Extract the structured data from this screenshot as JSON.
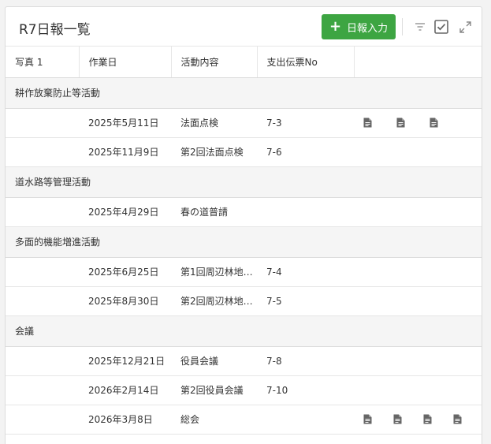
{
  "title": "R7日報一覧",
  "add_button": {
    "label": "日報入力",
    "color": "#3da542"
  },
  "toolbar": {
    "icons": [
      "filter-icon",
      "checkbox-icon",
      "expand-icon"
    ]
  },
  "columns": [
    "写真 1",
    "作業日",
    "活動内容",
    "支出伝票No",
    ""
  ],
  "groups": [
    {
      "name": "耕作放棄防止等活動",
      "rows": [
        {
          "date": "2025年5月11日",
          "activity": "法面点検",
          "voucher": "7-3",
          "attachments": 3
        },
        {
          "date": "2025年11月9日",
          "activity": "第2回法面点検",
          "voucher": "7-6",
          "attachments": 0
        }
      ]
    },
    {
      "name": "道水路等管理活動",
      "rows": [
        {
          "date": "2025年4月29日",
          "activity": "春の道普請",
          "voucher": "",
          "attachments": 0
        }
      ]
    },
    {
      "name": "多面的機能増進活動",
      "rows": [
        {
          "date": "2025年6月25日",
          "activity": "第1回周辺林地…",
          "voucher": "7-4",
          "attachments": 0
        },
        {
          "date": "2025年8月30日",
          "activity": "第2回周辺林地…",
          "voucher": "7-5",
          "attachments": 0
        }
      ]
    },
    {
      "name": "会議",
      "rows": [
        {
          "date": "2025年12月21日",
          "activity": "役員会議",
          "voucher": "7-8",
          "attachments": 0
        },
        {
          "date": "2026年2月14日",
          "activity": "第2回役員会議",
          "voucher": "7-10",
          "attachments": 0
        },
        {
          "date": "2026年3月8日",
          "activity": "総会",
          "voucher": "",
          "attachments": 4
        }
      ]
    }
  ]
}
